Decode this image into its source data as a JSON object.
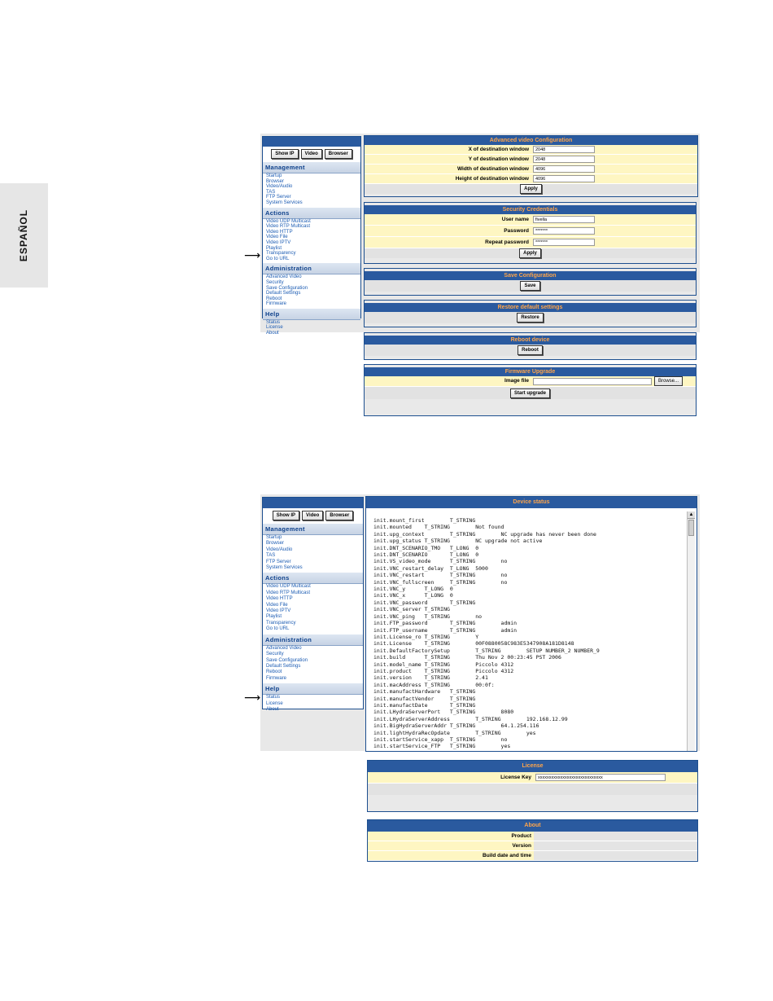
{
  "side_tab": "ESPAÑOL",
  "nav": {
    "buttons": [
      "Show IP",
      "Video",
      "Browser"
    ],
    "management": {
      "title": "Management",
      "items": [
        "Startup",
        "Browser",
        "Video/Audio",
        "TAS",
        "FTP Server",
        "System Services"
      ]
    },
    "actions": {
      "title": "Actions",
      "items": [
        "Video UDP Multicast",
        "Video RTP Multicast",
        "Video HTTP",
        "Video File",
        "Video IPTV",
        "Playlist",
        "Transparency",
        "Go to URL"
      ]
    },
    "administration": {
      "title": "Administration",
      "items": [
        "Advanced Video",
        "Security",
        "Save Configuration",
        "Default Settings",
        "Reboot",
        "Firmware"
      ]
    },
    "help": {
      "title": "Help",
      "items": [
        "Status",
        "License",
        "About"
      ]
    }
  },
  "advanced_video": {
    "title": "Advanced video Configuration",
    "fields": [
      {
        "label": "X of destination window",
        "value": "2048"
      },
      {
        "label": "Y of destination window",
        "value": "2048"
      },
      {
        "label": "Width of destination window",
        "value": "4096"
      },
      {
        "label": "Height of destination window",
        "value": "4096"
      }
    ],
    "apply": "Apply"
  },
  "security": {
    "title": "Security Credentials",
    "fields": [
      {
        "label": "User name",
        "value": "fivella"
      },
      {
        "label": "Password",
        "value": "*******"
      },
      {
        "label": "Repeat password",
        "value": "*******"
      }
    ],
    "apply": "Apply"
  },
  "save_config": {
    "title": "Save Configuration",
    "button": "Save"
  },
  "restore": {
    "title": "Restore default settings",
    "button": "Restore"
  },
  "reboot": {
    "title": "Reboot device",
    "button": "Reboot"
  },
  "firmware": {
    "title": "Firmware Upgrade",
    "label": "Image file",
    "browse": "Browse...",
    "start": "Start upgrade"
  },
  "device_status": {
    "title": "Device status",
    "lines": [
      "init.mount_first        T_STRING",
      "init.mounted    T_STRING        Not found",
      "init.upg_context        T_STRING        NC upgrade has never been done",
      "init.upg_status T_STRING        NC upgrade not active",
      "init.DNT_SCENARIO_TMO   T_LONG  0",
      "init.DNT_SCENARIO       T_LONG  0",
      "init.VS_video_mode      T_STRING        no",
      "init.VNC_restart_delay  T_LONG  5000",
      "init.VNC_restart        T_STRING        no",
      "init.VNC_fullscreen     T_STRING        no",
      "init.VNC_y      T_LONG  0",
      "init.VNC_x      T_LONG  0",
      "init.VNC_password       T_STRING",
      "init.VNC_server T_STRING",
      "init.VNC_ping   T_STRING        no",
      "init.FTP_password       T_STRING        admin",
      "init.FTP_username       T_STRING        admin",
      "init.License_ro T_STRING        Y",
      "init.License    T_STRING        00F0880058C983E5347908A181D8148",
      "init.DefaultFactorySetup        T_STRING        SETUP NUMBER_2 NUMBER_9",
      "init.build      T_STRING        Thu Nov 2 00:23:45 PST 2006",
      "init.model_name T_STRING        Piccolo 4312",
      "init.product    T_STRING        Piccolo 4312",
      "init.version    T_STRING        2.41",
      "init.macAddress T_STRING        00:0f:",
      "init.manufactHardware   T_STRING",
      "init.manufactVendor     T_STRING",
      "init.manufactDate       T_STRING",
      "init.LHydraServerPort   T_STRING        8080",
      "init.LHydraServerAddress        T_STRING        192.168.12.99",
      "init.BigHydraServerAddr T_STRING        64.1.254.116",
      "init.lightHydraRecOpdate        T_STRING        yes",
      "init.startService_xapp  T_STRING        no",
      "init.startService_FTP   T_STRING        yes"
    ]
  },
  "license": {
    "title": "License",
    "label": "License Key",
    "value": "xxxxxxxxxxxxxxxxxxxxxxxxxxxxx"
  },
  "about": {
    "title": "About",
    "fields": [
      "Product",
      "Version",
      "Build date and time"
    ]
  }
}
